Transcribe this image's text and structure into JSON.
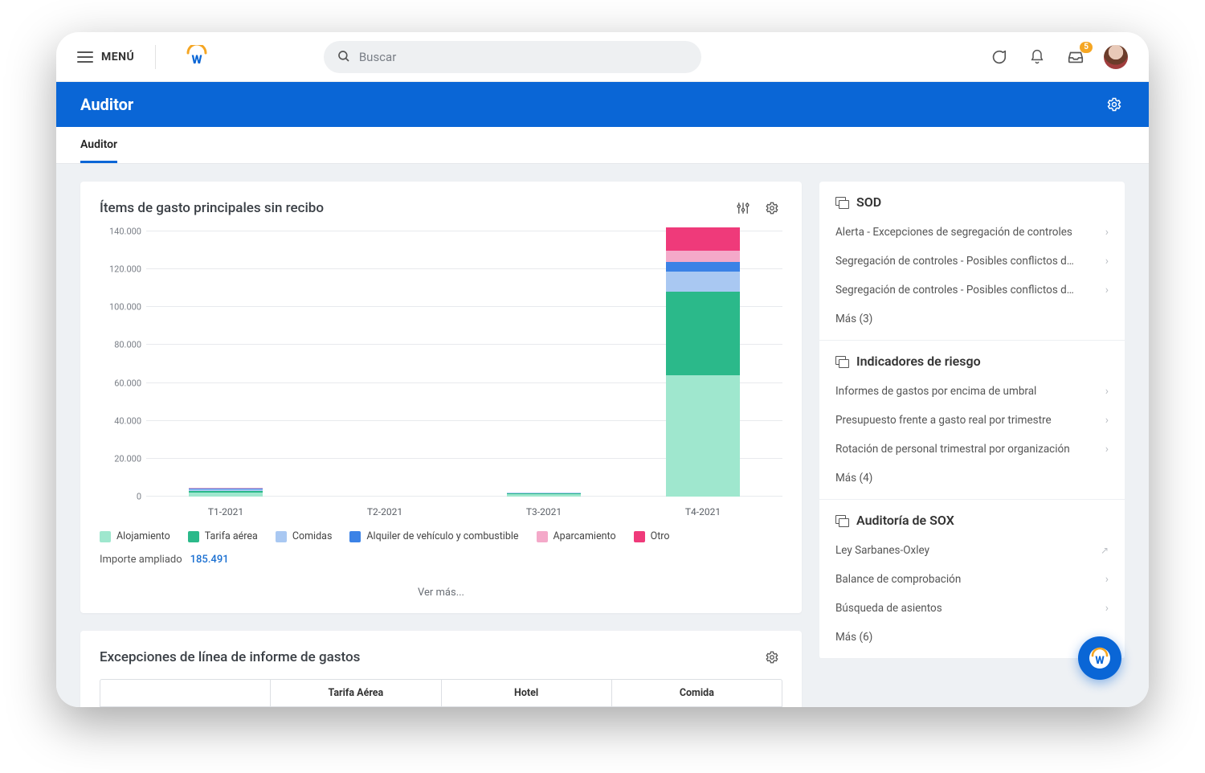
{
  "topbar": {
    "menu_label": "MENÚ",
    "search_placeholder": "Buscar",
    "inbox_badge": "5"
  },
  "title": "Auditor",
  "tabs": [
    {
      "label": "Auditor",
      "active": true
    }
  ],
  "chart_data": {
    "type": "bar",
    "card_title": "Ítems de gasto principales sin recibo",
    "xlabel": "",
    "ylabel": "",
    "ylim": [
      0,
      140000
    ],
    "y_ticks": [
      "0",
      "20.000",
      "40.000",
      "60.000",
      "80.000",
      "100.000",
      "120.000",
      "140.000"
    ],
    "categories": [
      "T1-2021",
      "T2-2021",
      "T3-2021",
      "T4-2021"
    ],
    "series": [
      {
        "name": "Alojamiento",
        "color": "#9fe7ce",
        "values": [
          11000,
          300,
          8500,
          64000
        ]
      },
      {
        "name": "Tarifa aérea",
        "color": "#2bb98a",
        "values": [
          5000,
          200,
          4000,
          44000
        ]
      },
      {
        "name": "Comidas",
        "color": "#a9c8f2",
        "values": [
          5500,
          100,
          2500,
          11000
        ]
      },
      {
        "name": "Alquiler de vehículo y combustible",
        "color": "#3b82e6",
        "values": [
          1500,
          100,
          1000,
          5000
        ]
      },
      {
        "name": "Aparcamiento",
        "color": "#f4a9c9",
        "values": [
          1500,
          100,
          500,
          6000
        ]
      },
      {
        "name": "Otro",
        "color": "#ef3a7a",
        "values": [
          1500,
          100,
          1500,
          12000
        ]
      }
    ],
    "total_label": "Importe ampliado",
    "total_value": "185.491",
    "more_link": "Ver más..."
  },
  "exceptions": {
    "title": "Excepciones de línea de informe de gastos",
    "columns": [
      "Tarifa Aérea",
      "Hotel",
      "Comida"
    ]
  },
  "side": {
    "sections": [
      {
        "title": "SOD",
        "items": [
          "Alerta - Excepciones de segregación de controles",
          "Segregación de controles - Posibles conflictos de pr…",
          "Segregación de controles - Posibles conflictos de cli…"
        ],
        "more": "Más (3)"
      },
      {
        "title": "Indicadores de riesgo",
        "items": [
          "Informes de gastos por encima de umbral",
          "Presupuesto frente a gasto real por trimestre",
          "Rotación de personal trimestral por organización"
        ],
        "more": "Más (4)"
      },
      {
        "title": "Auditoría de SOX",
        "items": [
          "Ley Sarbanes-Oxley",
          "Balance de comprobación",
          "Búsqueda de asientos"
        ],
        "more": "Más (6)",
        "first_external": true
      }
    ]
  }
}
